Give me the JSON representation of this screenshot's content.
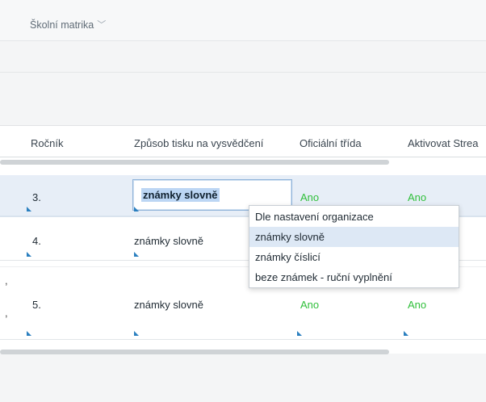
{
  "breadcrumb": {
    "label": "Školní matrika",
    "chevron": "chevron-down-icon"
  },
  "table": {
    "headers": [
      "Ročník",
      "Způsob tisku na vysvědčení",
      "Oficiální třída",
      "Aktivovat Strea"
    ],
    "rows": [
      {
        "grade": "3.",
        "print_mode": "známky slovně",
        "official": "Ano",
        "activate": "Ano"
      },
      {
        "grade": "4.",
        "print_mode": "známky slovně",
        "official": "",
        "activate": ""
      },
      {
        "grade": "5.",
        "print_mode": "známky slovně",
        "official": "Ano",
        "activate": "Ano"
      }
    ]
  },
  "dropdown": {
    "options": [
      "Dle nastavení organizace",
      "známky slovně",
      "známky číslicí",
      "beze známek - ruční vyplnění"
    ],
    "selected_index": 1
  },
  "row_markers": [
    ",",
    ","
  ],
  "colors": {
    "yes_green": "#2fbf3a",
    "selection_bg": "#e7eef7",
    "accent_blue": "#2a7fbf"
  }
}
